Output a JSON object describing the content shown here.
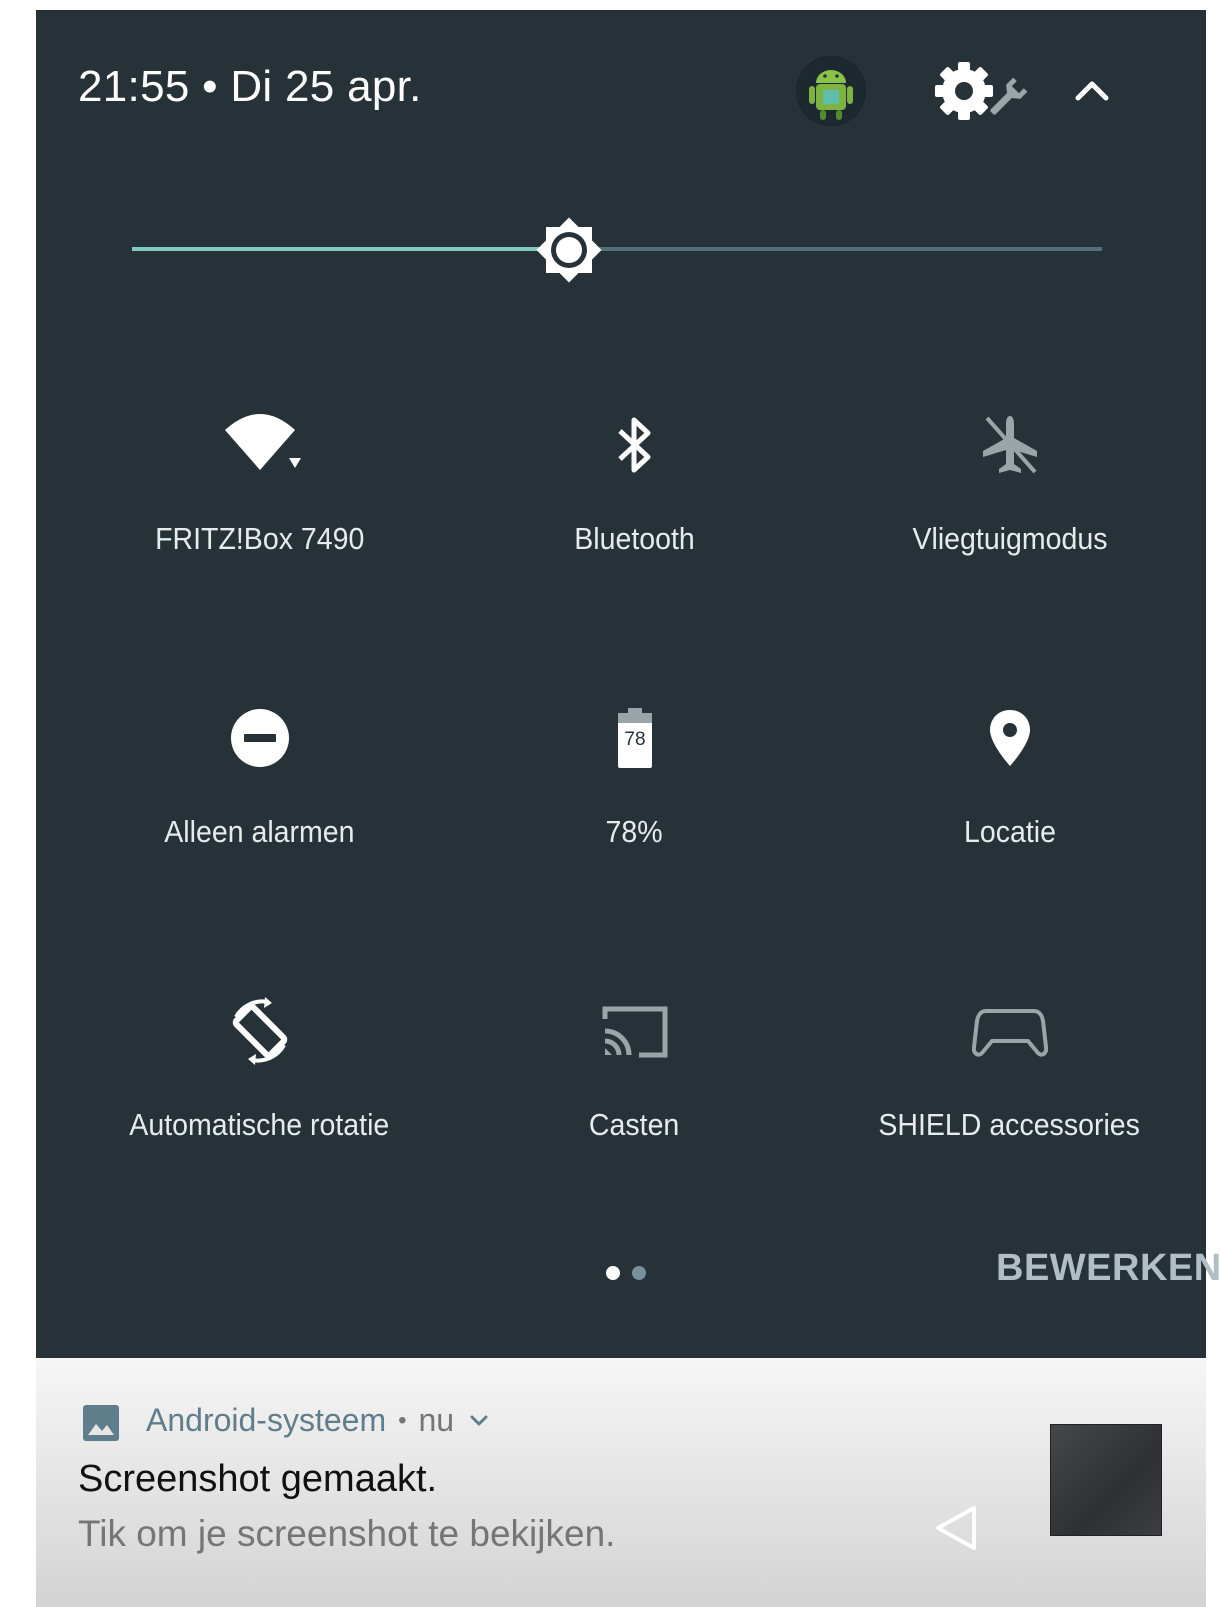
{
  "header": {
    "datetime": "21:55 • Di 25 apr."
  },
  "brightness": {
    "level": 0.45
  },
  "tiles": [
    {
      "label": "FRITZ!Box 7490",
      "icon": "wifi-icon"
    },
    {
      "label": "Bluetooth",
      "icon": "bluetooth-icon"
    },
    {
      "label": "Vliegtuigmodus",
      "icon": "airplane-icon"
    },
    {
      "label": "Alleen alarmen",
      "icon": "do-not-disturb-icon"
    },
    {
      "label": "78%",
      "icon": "battery-icon",
      "battery_text": "78"
    },
    {
      "label": "Locatie",
      "icon": "location-pin-icon"
    },
    {
      "label": "Automatische rotatie",
      "icon": "auto-rotate-icon"
    },
    {
      "label": "Casten",
      "icon": "cast-icon"
    },
    {
      "label": "SHIELD accessories",
      "icon": "gamepad-icon"
    }
  ],
  "pager": {
    "pages": 2,
    "active": 0
  },
  "edit_label": "BEWERKEN",
  "notification": {
    "app_name": "Android-systeem",
    "separator": "•",
    "time": "nu",
    "title": "Screenshot gemaakt.",
    "text": "Tik om je screenshot te bekijken."
  },
  "colors": {
    "panel_bg": "#263238",
    "accent": "#80cbc4",
    "tile_inactive": "#9aa5a9",
    "icon_active": "#ffffff"
  }
}
